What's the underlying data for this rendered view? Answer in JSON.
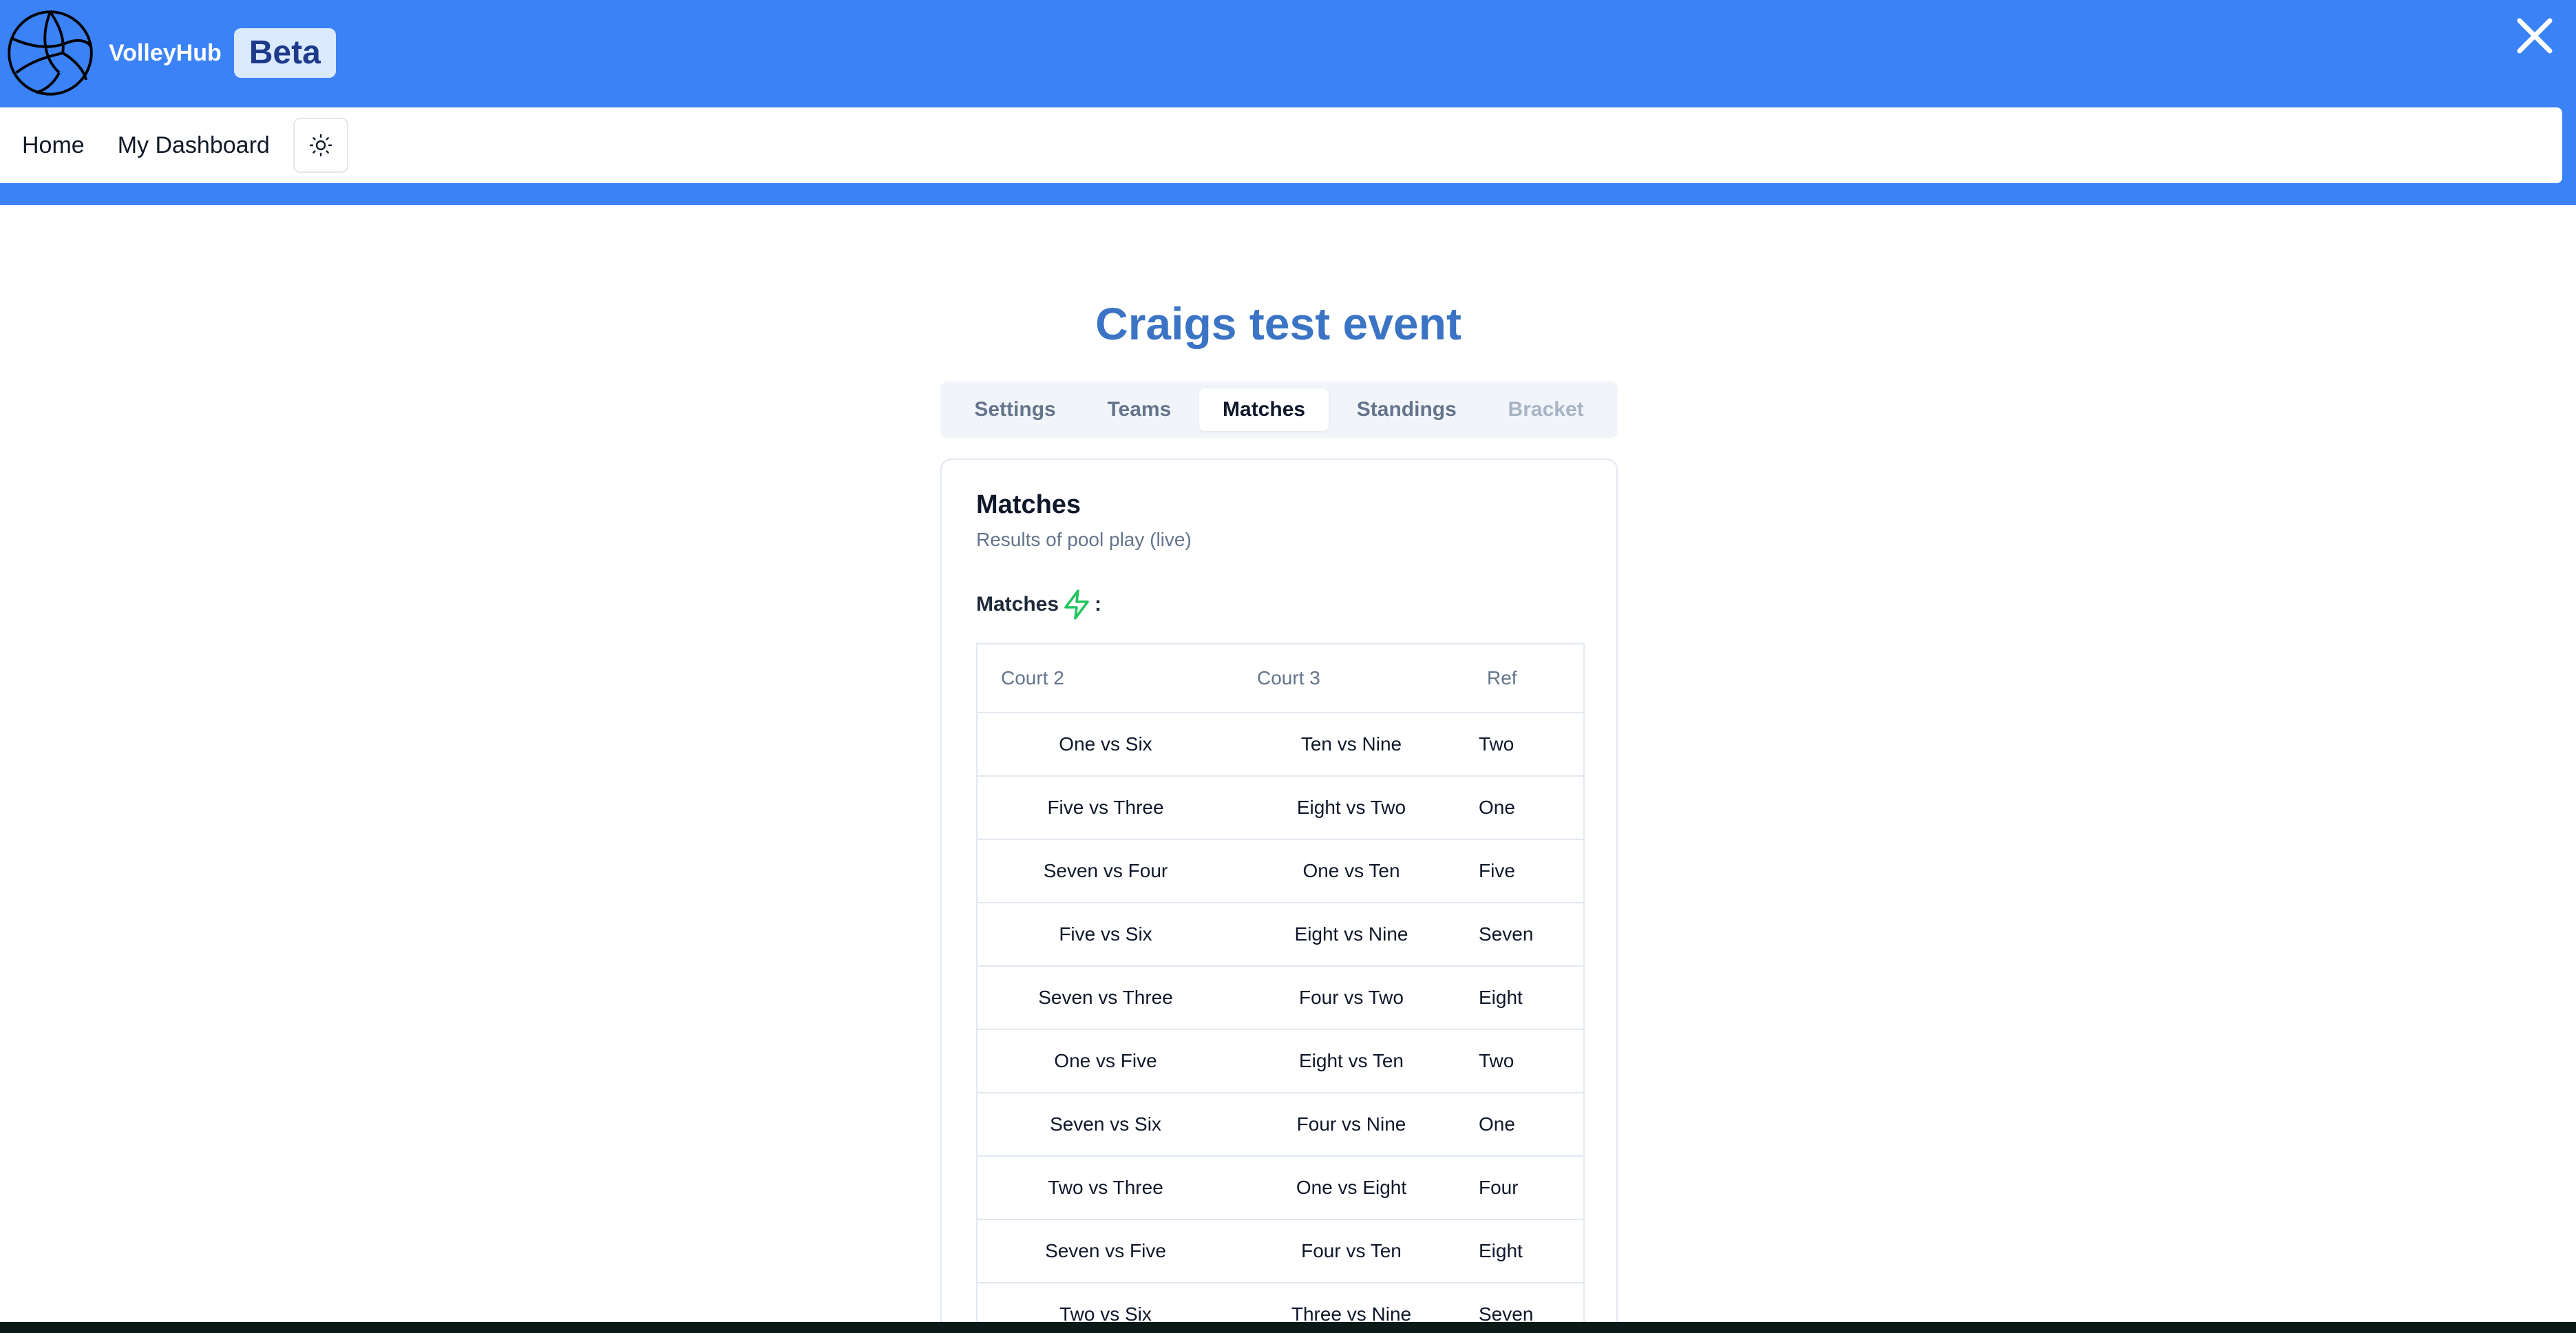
{
  "app": {
    "name": "VolleyHub",
    "badge": "Beta"
  },
  "nav": {
    "home": "Home",
    "dashboard": "My Dashboard",
    "theme_icon": "sun-icon"
  },
  "event": {
    "title": "Craigs test event"
  },
  "tabs": [
    {
      "label": "Settings",
      "state": "normal"
    },
    {
      "label": "Teams",
      "state": "normal"
    },
    {
      "label": "Matches",
      "state": "active"
    },
    {
      "label": "Standings",
      "state": "normal"
    },
    {
      "label": "Bracket",
      "state": "disabled"
    }
  ],
  "card": {
    "title": "Matches",
    "description": "Results of pool play (live)",
    "matches_label": "Matches",
    "matches_suffix": ":",
    "live_icon": "lightning-icon"
  },
  "table": {
    "headers": [
      "Court 2",
      "Court 3",
      "Ref"
    ],
    "rows": [
      [
        "One vs Six",
        "Ten vs Nine",
        "Two"
      ],
      [
        "Five vs Three",
        "Eight vs Two",
        "One"
      ],
      [
        "Seven vs Four",
        "One vs Ten",
        "Five"
      ],
      [
        "Five vs Six",
        "Eight vs Nine",
        "Seven"
      ],
      [
        "Seven vs Three",
        "Four vs Two",
        "Eight"
      ],
      [
        "One vs Five",
        "Eight vs Ten",
        "Two"
      ],
      [
        "Seven vs Six",
        "Four vs Nine",
        "One"
      ],
      [
        "Two vs Three",
        "One vs Eight",
        "Four"
      ],
      [
        "Seven vs Five",
        "Four vs Ten",
        "Eight"
      ],
      [
        "Two vs Six",
        "Three vs Nine",
        "Seven"
      ]
    ]
  },
  "colors": {
    "header_blue": "#3b82f6",
    "title_blue": "#3b74c4",
    "badge_bg": "#dbeafe",
    "live_green": "#22c55e"
  }
}
